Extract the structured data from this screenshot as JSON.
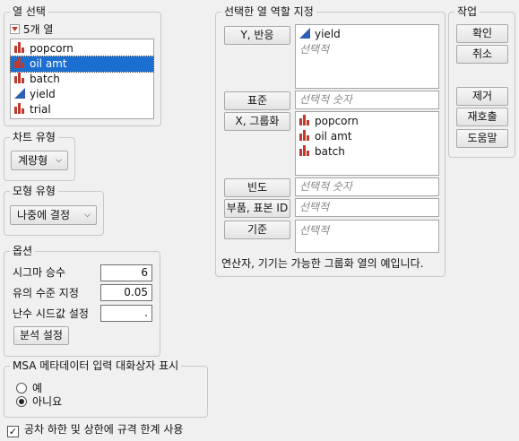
{
  "select_columns": {
    "title": "열 선택",
    "count_label": "5개 열",
    "columns": [
      {
        "name": "popcorn",
        "icon": "nominal-bar-icon",
        "selected": false
      },
      {
        "name": "oil amt",
        "icon": "nominal-bar-icon",
        "selected": true
      },
      {
        "name": "batch",
        "icon": "nominal-bar-icon",
        "selected": false
      },
      {
        "name": "yield",
        "icon": "continuous-triangle-icon",
        "selected": false
      },
      {
        "name": "trial",
        "icon": "nominal-bar-icon",
        "selected": false
      }
    ]
  },
  "chart_type": {
    "title": "차트 유형",
    "value": "계량형"
  },
  "model_type": {
    "title": "모형 유형",
    "value": "나중에 결정"
  },
  "options": {
    "title": "옵션",
    "sigma_label": "시그마 승수",
    "sigma_value": "6",
    "alpha_label": "유의 수준 지정",
    "alpha_value": "0.05",
    "seed_label": "난수 시드값 설정",
    "seed_value": ".",
    "analysis_button": "분석 설정"
  },
  "msa_metadata": {
    "title": "MSA 메타데이터 입력 대화상자 표시",
    "yes": "예",
    "no": "아니요",
    "selected": "no"
  },
  "spec_limits_checkbox": {
    "label": "공차 하한 및 상한에 규격 한계 사용",
    "checked": true
  },
  "roles": {
    "title": "선택한 열 역할 지정",
    "y_button": "Y, 반응",
    "y_items": [
      "yield"
    ],
    "y_placeholder": "선택적",
    "standard_button": "표준",
    "standard_placeholder": "선택적 숫자",
    "x_button": "X, 그룹화",
    "x_items": [
      "popcorn",
      "oil amt",
      "batch"
    ],
    "freq_button": "빈도",
    "freq_placeholder": "선택적 숫자",
    "part_button": "부품, 표본 ID",
    "part_placeholder": "선택적",
    "by_button": "기준",
    "by_placeholder": "선택적",
    "note": "연산자, 기기는 가능한 그룹화 열의 예입니다."
  },
  "actions": {
    "title": "작업",
    "ok": "확인",
    "cancel": "취소",
    "remove": "제거",
    "recall": "재호출",
    "help": "도움말"
  },
  "colors": {
    "nominal": "#c0392b",
    "continuous": "#2e5fb4",
    "selection": "#1a6fd1"
  }
}
